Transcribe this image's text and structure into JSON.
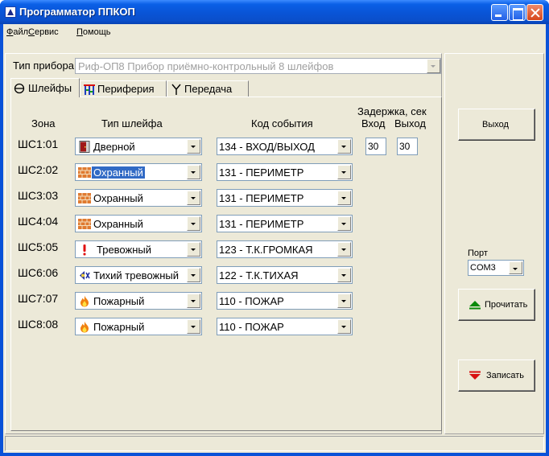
{
  "window": {
    "title": "Программатор ППКОП"
  },
  "menu": [
    {
      "first": "Ф",
      "rest": "айл"
    },
    {
      "first": "С",
      "rest": "ервис"
    },
    {
      "first": "П",
      "rest": "омощь"
    }
  ],
  "device": {
    "label": "Тип прибора",
    "value": "Риф-ОП8 Прибор приёмно-контрольный 8 шлейфов"
  },
  "tabs": [
    {
      "label": "Шлейфы",
      "icon": "loop-icon",
      "active": true
    },
    {
      "label": "Периферия",
      "icon": "peripheral-icon",
      "active": false
    },
    {
      "label": "Передача",
      "icon": "antenna-icon",
      "active": false
    }
  ],
  "columns": {
    "zone": "Зона",
    "loop_type": "Тип шлейфа",
    "event_code": "Код события",
    "delay": "Задержка, сек",
    "delay_in": "Вход",
    "delay_out": "Выход"
  },
  "loops": [
    {
      "zone": "ШС1:01",
      "type": "Дверной",
      "type_icon": "door-icon",
      "code": "134 - ВХОД/ВЫХОД",
      "delay_in": "30",
      "delay_out": "30",
      "selected": false
    },
    {
      "zone": "ШС2:02",
      "type": "Охранный",
      "type_icon": "wall-icon",
      "code": "131 - ПЕРИМЕТР",
      "selected": true
    },
    {
      "zone": "ШС3:03",
      "type": "Охранный",
      "type_icon": "wall-icon",
      "code": "131 - ПЕРИМЕТР",
      "selected": false
    },
    {
      "zone": "ШС4:04",
      "type": "Охранный",
      "type_icon": "wall-icon",
      "code": "131 - ПЕРИМЕТР",
      "selected": false
    },
    {
      "zone": "ШС5:05",
      "type": "Тревожный",
      "type_icon": "alarm-icon",
      "code": "123 - Т.К.ГРОМКАЯ",
      "selected": false
    },
    {
      "zone": "ШС6:06",
      "type": "Тихий тревожный",
      "type_icon": "silent-alarm-icon",
      "code": "122 - Т.К.ТИХАЯ",
      "selected": false
    },
    {
      "zone": "ШС7:07",
      "type": "Пожарный",
      "type_icon": "fire-icon",
      "code": "110 - ПОЖАР",
      "selected": false
    },
    {
      "zone": "ШС8:08",
      "type": "Пожарный",
      "type_icon": "fire-icon",
      "code": "110 - ПОЖАР",
      "selected": false
    }
  ],
  "side": {
    "exit_label": "Выход",
    "port_label": "Порт",
    "port_value": "COM3",
    "read_label": "Прочитать",
    "write_label": "Записать"
  },
  "colors": {
    "title_bar": "#0a52d8",
    "window_face": "#ece9d8",
    "selection": "#316ac5",
    "read_arrow": "#0a8a0a",
    "write_arrow": "#d81010"
  }
}
